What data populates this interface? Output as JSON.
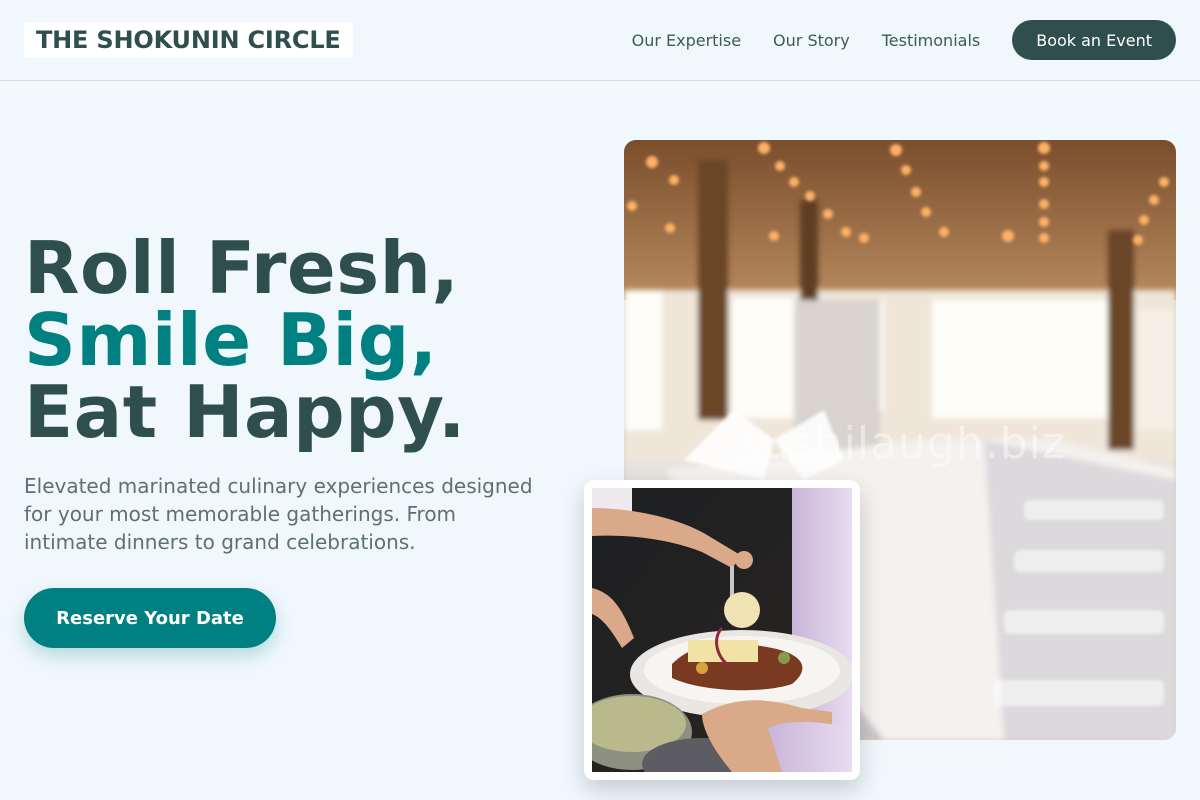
{
  "brand": {
    "name": "THE SHOKUNIN CIRCLE"
  },
  "nav": {
    "links": [
      "Our Expertise",
      "Our Story",
      "Testimonials"
    ],
    "cta_label": "Book an Event"
  },
  "hero": {
    "line1": "Roll Fresh,",
    "line2": "Smile Big,",
    "line3": "Eat Happy.",
    "subtext": "Elevated marinated culinary experiences designed for your most memorable gatherings. From intimate dinners to grand celebrations.",
    "cta_label": "Reserve Your Date"
  },
  "images": {
    "venue_watermark": "sushilaugh.biz"
  },
  "colors": {
    "primary": "#2f4f4f",
    "accent": "#008080",
    "background": "#f0f8fd"
  }
}
